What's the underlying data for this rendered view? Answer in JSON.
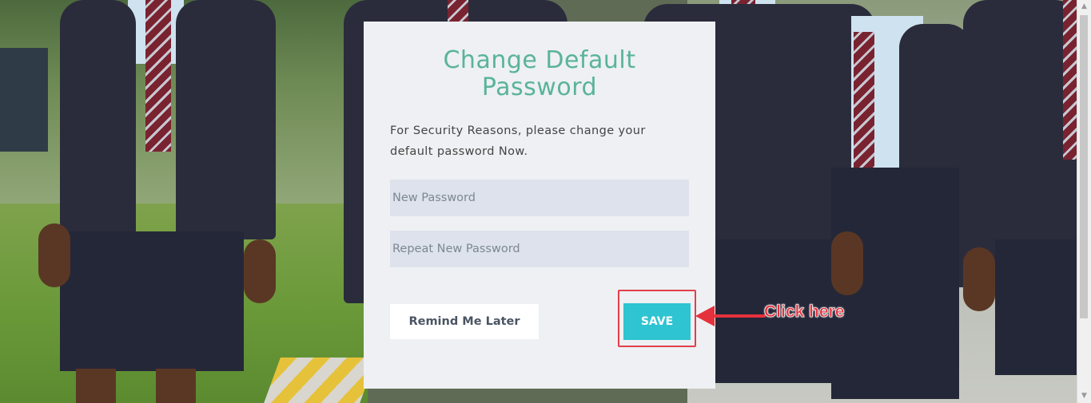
{
  "card": {
    "title_line1": "Change Default",
    "title_line2": "Password",
    "description": "For Security Reasons, please change your default password Now.",
    "new_password_placeholder": "New Password",
    "repeat_password_placeholder": "Repeat New Password",
    "remind_label": "Remind Me Later",
    "save_label": "SAVE"
  },
  "annotation": {
    "label": "Click here",
    "color": "#e5313c"
  },
  "colors": {
    "title": "#5ab39c",
    "save_button": "#2ec4d1",
    "card_background": "#eef0f3",
    "field_background": "#dde2ec"
  }
}
